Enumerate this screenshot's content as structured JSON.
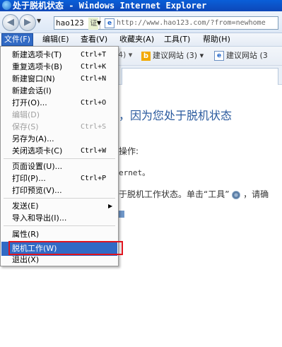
{
  "window": {
    "title": "处于脱机状态 - Windows Internet Explorer"
  },
  "navbar": {
    "back_icon": "back-arrow-icon",
    "forward_icon": "forward-arrow-icon",
    "address_site": "hao123",
    "address_cert": "证",
    "address_url": "http://www.hao123.com/?from=newhome"
  },
  "menubar": {
    "file": "文件(F)",
    "edit": "编辑(E)",
    "view": "查看(V)",
    "favorites": "收藏夹(A)",
    "tools": "工具(T)",
    "help": "帮助(H)"
  },
  "favbar": {
    "fragment": "4) ▾",
    "fav1": "建议网站 (3) ▾",
    "fav2": "建议网站 (3"
  },
  "file_menu": {
    "items": [
      {
        "label": "新建选项卡(T)",
        "shortcut": "Ctrl+T",
        "enabled": true
      },
      {
        "label": "重复选项卡(B)",
        "shortcut": "Ctrl+K",
        "enabled": true
      },
      {
        "label": "新建窗口(N)",
        "shortcut": "Ctrl+N",
        "enabled": true
      },
      {
        "label": "新建会话(I)",
        "shortcut": "",
        "enabled": true
      },
      {
        "label": "打开(O)...",
        "shortcut": "Ctrl+O",
        "enabled": true
      },
      {
        "label": "编辑(D)",
        "shortcut": "",
        "enabled": false
      },
      {
        "label": "保存(S)",
        "shortcut": "Ctrl+S",
        "enabled": false
      },
      {
        "label": "另存为(A)...",
        "shortcut": "",
        "enabled": true
      },
      {
        "label": "关闭选项卡(C)",
        "shortcut": "Ctrl+W",
        "enabled": true
      },
      {
        "label": "页面设置(U)...",
        "shortcut": "",
        "enabled": true
      },
      {
        "label": "打印(P)...",
        "shortcut": "Ctrl+P",
        "enabled": true
      },
      {
        "label": "打印预览(V)...",
        "shortcut": "",
        "enabled": true
      },
      {
        "label": "发送(E)",
        "shortcut": "",
        "enabled": true,
        "submenu": true
      },
      {
        "label": "导入和导出(I)...",
        "shortcut": "",
        "enabled": true
      },
      {
        "label": "属性(R)",
        "shortcut": "",
        "enabled": true
      },
      {
        "label": "脱机工作(W)",
        "shortcut": "",
        "enabled": true,
        "highlighted": true
      },
      {
        "label": "退出(X)",
        "shortcut": "",
        "enabled": true
      }
    ]
  },
  "page": {
    "heading_fragment": "，因为您处于脱机状态",
    "op_fragment": "操作:",
    "net_fragment": "ernet。",
    "desc_fragment": "于脱机工作状态。单击“工具”",
    "desc_tail": "，请确"
  },
  "colors": {
    "menu_highlight": "#316ac5",
    "annotation_red": "#e0141e",
    "heading_blue": "#2a5a9e"
  }
}
